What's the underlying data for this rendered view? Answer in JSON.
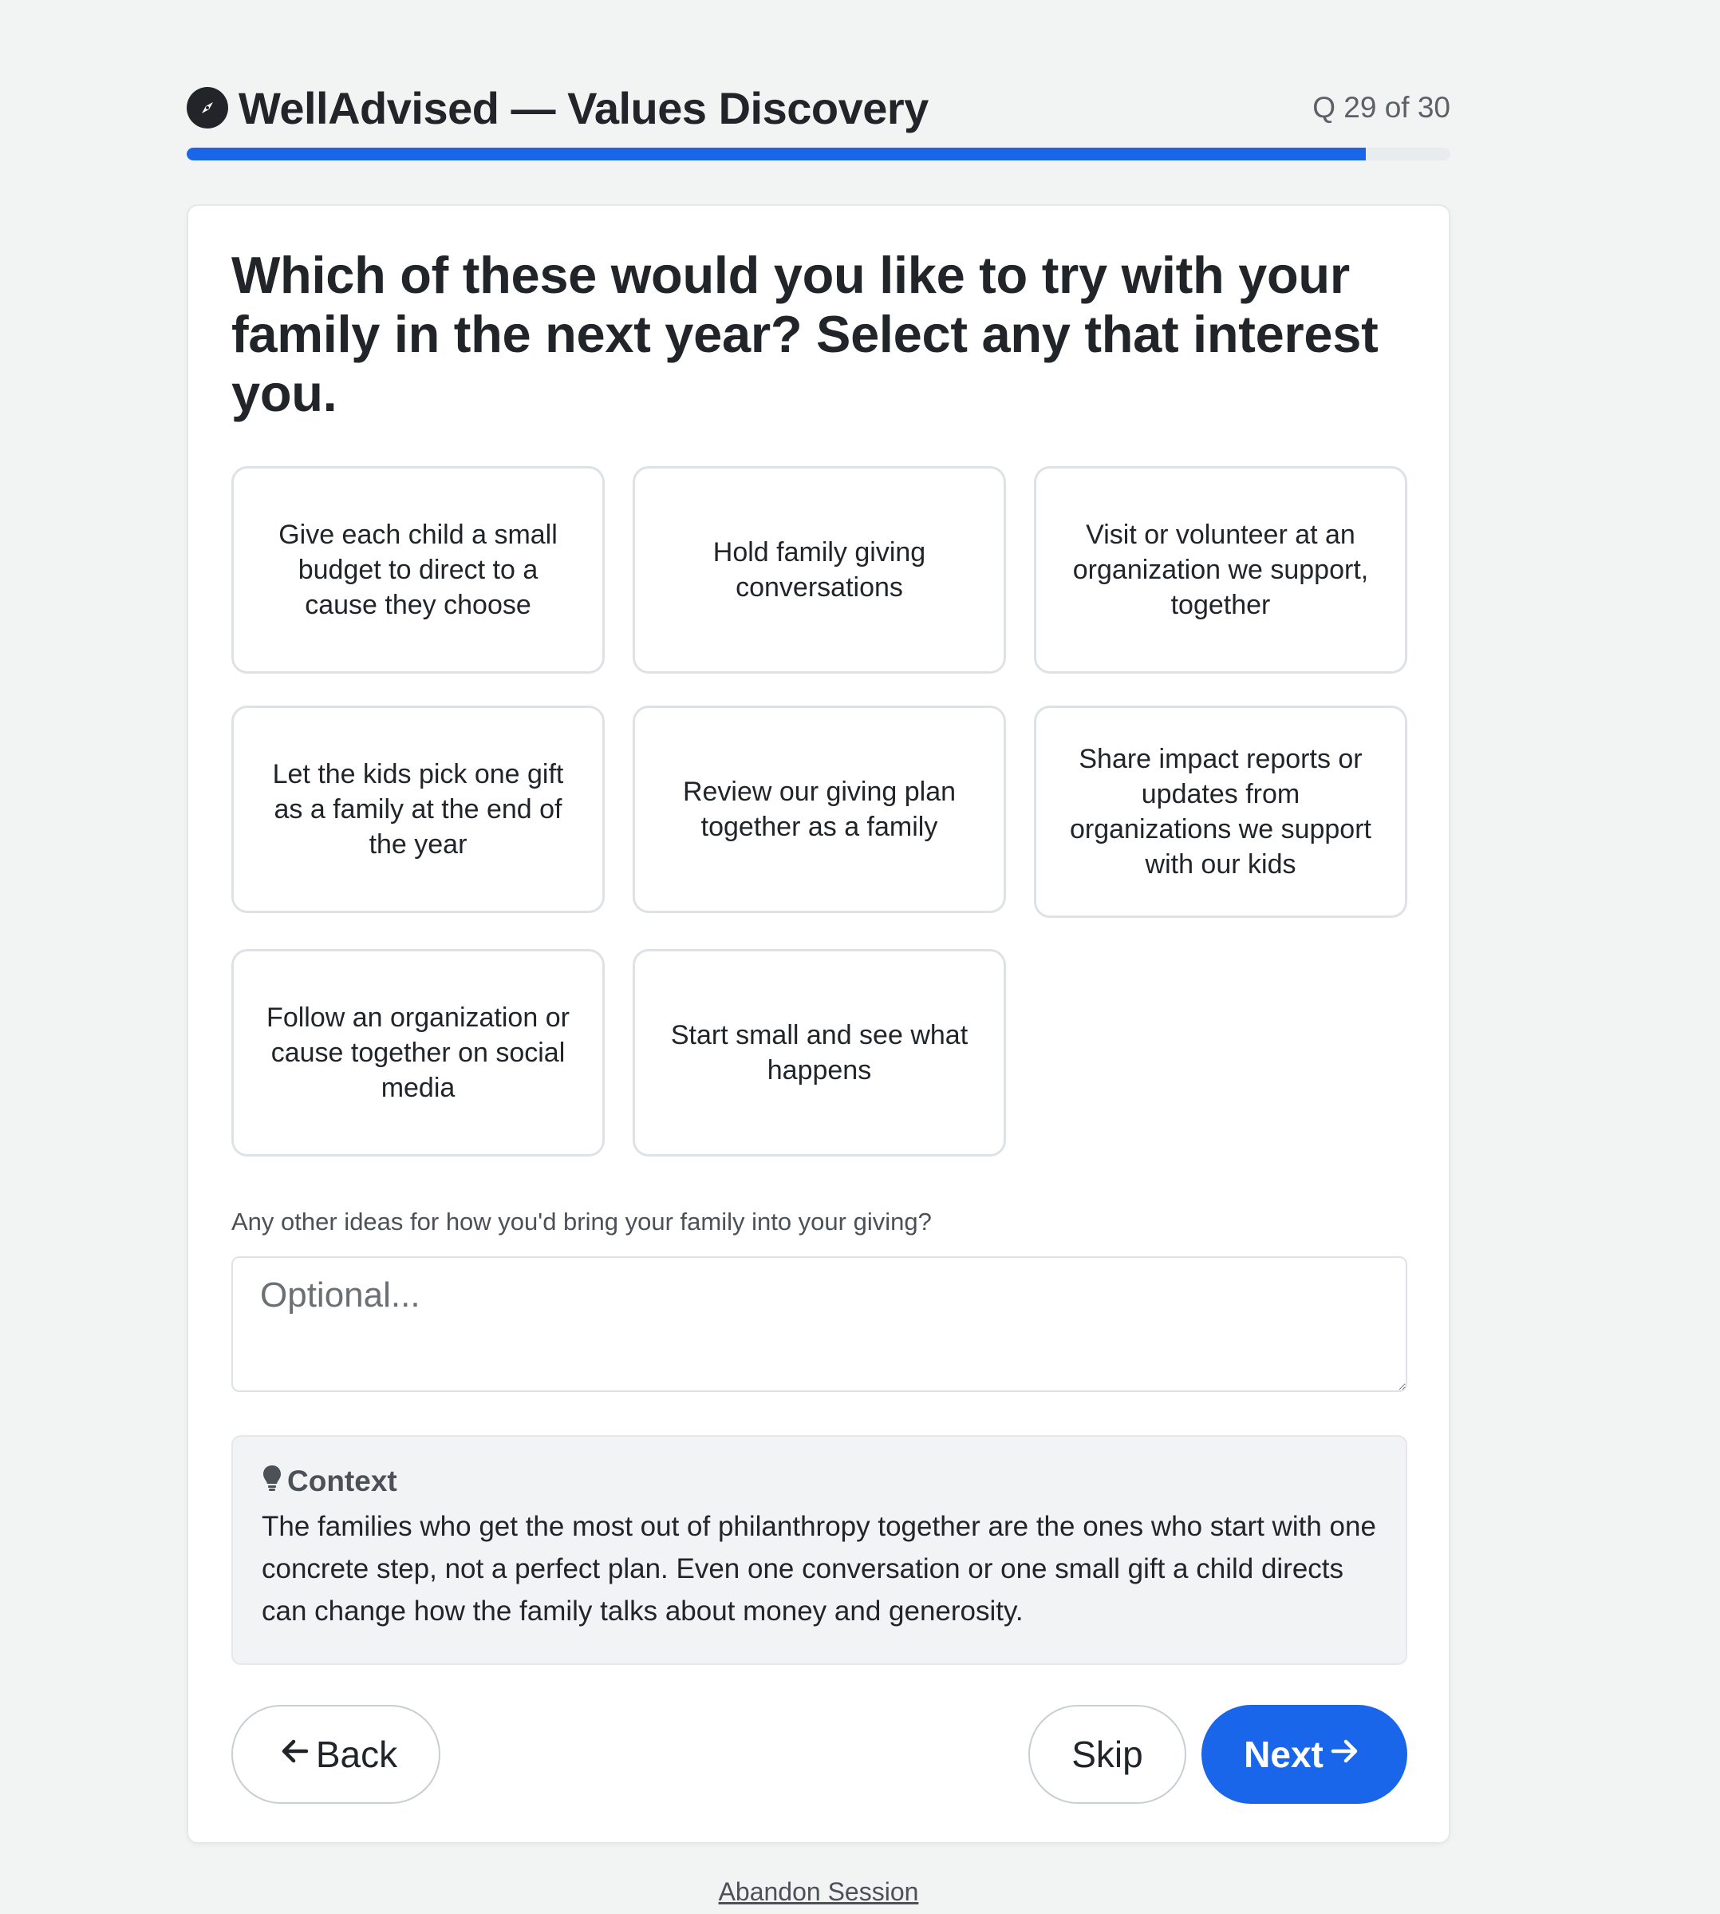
{
  "header": {
    "brand_icon": "compass-icon",
    "title": "WellAdvised — Values Discovery",
    "question_counter": "Q 29 of 30",
    "progress_fraction": 0.9333
  },
  "question": {
    "prompt": "Which of these would you like to try with your family in the next year? Select any that interest you."
  },
  "options": [
    {
      "label": "Give each child a small budget to direct to a cause they choose",
      "selected": false
    },
    {
      "label": "Hold family giving conversations",
      "selected": false
    },
    {
      "label": "Visit or volunteer at an organization we support, together",
      "selected": false
    },
    {
      "label": "Let the kids pick one gift as a family at the end of the year",
      "selected": false
    },
    {
      "label": "Review our giving plan together as a family",
      "selected": false
    },
    {
      "label": "Share impact reports or updates from organizations we support with our kids",
      "selected": false
    },
    {
      "label": "Follow an organization or cause together on social media",
      "selected": false
    },
    {
      "label": "Start small and see what happens",
      "selected": false
    }
  ],
  "free_text": {
    "label": "Any other ideas for how you'd bring your family into your giving?",
    "placeholder": "Optional...",
    "value": ""
  },
  "context": {
    "icon": "lightbulb-icon",
    "title": "Context",
    "body": "The families who get the most out of philanthropy together are the ones who start with one concrete step, not a perfect plan. Even one conversation or one small gift a child directs can change how the family talks about money and generosity."
  },
  "buttons": {
    "back_label": "Back",
    "back_icon": "arrow-left-icon",
    "skip_label": "Skip",
    "next_label": "Next",
    "next_icon": "arrow-right-icon"
  },
  "footer": {
    "abandon_label": "Abandon Session"
  },
  "colors": {
    "accent": "#1a66eb",
    "page_bg": "#f2f3f3",
    "text": "#212529"
  }
}
